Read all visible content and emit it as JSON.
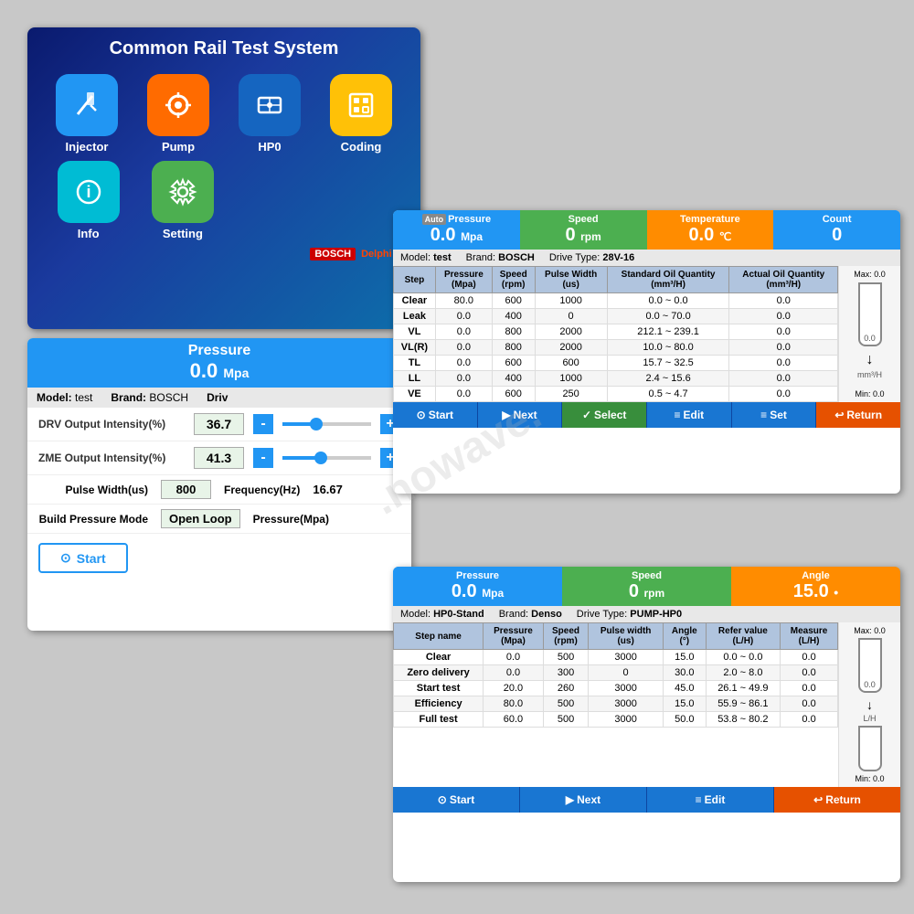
{
  "app": {
    "title": "Common Rail Test System",
    "watermark": ".nowave."
  },
  "main_menu": {
    "title": "Common Rail Test System",
    "items": [
      {
        "label": "Injector",
        "icon": "💉",
        "color": "blue"
      },
      {
        "label": "Pump",
        "icon": "🔧",
        "color": "orange"
      },
      {
        "label": "HP0",
        "icon": "⚙️",
        "color": "dark-blue"
      },
      {
        "label": "Coding",
        "icon": "📱",
        "color": "yellow"
      },
      {
        "label": "Info",
        "icon": "ℹ️",
        "color": "cyan"
      },
      {
        "label": "Setting",
        "icon": "⚙️",
        "color": "green"
      }
    ],
    "logos": "BOSCH  Delphi  DE"
  },
  "injector_panel": {
    "header": {
      "title": "Pressure",
      "value": "0.0",
      "unit": "Mpa"
    },
    "model_row": {
      "model_label": "Model:",
      "model_val": "test",
      "brand_label": "Brand:",
      "brand_val": "BOSCH",
      "drive_label": "Driv"
    },
    "controls": [
      {
        "label": "DRV Output Intensity(%)",
        "value": "36.7",
        "fill_pct": 38
      },
      {
        "label": "ZME Output Intensity(%)",
        "value": "41.3",
        "fill_pct": 43
      }
    ],
    "fields": [
      {
        "label": "Pulse Width(us)",
        "value": "800",
        "label2": "Frequency(Hz)",
        "val2": "16.67"
      },
      {
        "label": "Build Pressure Mode",
        "value": "Open Loop",
        "label2": "Pressure(Mpa)",
        "val2": ""
      }
    ],
    "start_btn": "Start"
  },
  "test_panel": {
    "header": {
      "pressure_label": "Pressure",
      "pressure_val": "0.0",
      "pressure_unit": "Mpa",
      "speed_label": "Speed",
      "speed_val": "0",
      "speed_unit": "rpm",
      "temp_label": "Temperature",
      "temp_val": "0.0",
      "temp_unit": "℃",
      "count_label": "Count",
      "count_val": "0"
    },
    "model_row": {
      "model": "test",
      "brand": "BOSCH",
      "drive_type": "28V-16"
    },
    "table": {
      "headers": [
        "Step",
        "Pressure\n(Mpa)",
        "Speed\n(rpm)",
        "Pulse Width\n(us)",
        "Standard Oil Quantity\n(mm³/H)",
        "Actual Oil Quantity\n(mm³/H)"
      ],
      "rows": [
        {
          "step": "Clear",
          "pressure": "80.0",
          "speed": "600",
          "pulse": "1000",
          "standard": "0.0 ~ 0.0",
          "actual": "0.0"
        },
        {
          "step": "Leak",
          "pressure": "0.0",
          "speed": "400",
          "pulse": "0",
          "standard": "0.0 ~ 70.0",
          "actual": "0.0"
        },
        {
          "step": "VL",
          "pressure": "0.0",
          "speed": "800",
          "pulse": "2000",
          "standard": "212.1 ~ 239.1",
          "actual": "0.0"
        },
        {
          "step": "VL(R)",
          "pressure": "0.0",
          "speed": "800",
          "pulse": "2000",
          "standard": "10.0 ~ 80.0",
          "actual": "0.0"
        },
        {
          "step": "TL",
          "pressure": "0.0",
          "speed": "600",
          "pulse": "600",
          "standard": "15.7 ~ 32.5",
          "actual": "0.0"
        },
        {
          "step": "LL",
          "pressure": "0.0",
          "speed": "400",
          "pulse": "1000",
          "standard": "2.4 ~ 15.6",
          "actual": "0.0"
        },
        {
          "step": "VE",
          "pressure": "0.0",
          "speed": "600",
          "pulse": "250",
          "standard": "0.5 ~ 4.7",
          "actual": "0.0"
        }
      ]
    },
    "gauge": {
      "max": "Max: 0.0",
      "min": "Min: 0.0",
      "unit": "mm³/H"
    },
    "buttons": [
      {
        "label": "Start",
        "icon": "▶"
      },
      {
        "label": "Next",
        "icon": "▶"
      },
      {
        "label": "Select",
        "icon": "✓"
      },
      {
        "label": "Edit",
        "icon": "≡"
      },
      {
        "label": "Set",
        "icon": "≡"
      },
      {
        "label": "Return",
        "icon": "↩"
      }
    ]
  },
  "hp0_panel": {
    "header": {
      "pressure_label": "Pressure",
      "pressure_val": "0.0",
      "pressure_unit": "Mpa",
      "speed_label": "Speed",
      "speed_val": "0",
      "speed_unit": "rpm",
      "angle_label": "Angle",
      "angle_val": "15.0",
      "angle_unit": "•"
    },
    "model_row": {
      "model": "HP0-Stand",
      "brand": "Denso",
      "drive_type": "PUMP-HP0"
    },
    "table": {
      "headers": [
        "Step name",
        "Pressure\n(Mpa)",
        "Speed\n(rpm)",
        "Pulse width\n(us)",
        "Angle\n(°)",
        "Refer value\n(L/H)",
        "Measure\n(L/H)"
      ],
      "rows": [
        {
          "step": "Clear",
          "pressure": "0.0",
          "speed": "500",
          "pulse": "3000",
          "angle": "15.0",
          "refer": "0.0 ~ 0.0",
          "measure": "0.0"
        },
        {
          "step": "Zero delivery",
          "pressure": "0.0",
          "speed": "300",
          "pulse": "0",
          "angle": "30.0",
          "refer": "2.0 ~ 8.0",
          "measure": "0.0"
        },
        {
          "step": "Start test",
          "pressure": "20.0",
          "speed": "260",
          "pulse": "3000",
          "angle": "45.0",
          "refer": "26.1 ~ 49.9",
          "measure": "0.0"
        },
        {
          "step": "Efficiency",
          "pressure": "80.0",
          "speed": "500",
          "pulse": "3000",
          "angle": "15.0",
          "refer": "55.9 ~ 86.1",
          "measure": "0.0"
        },
        {
          "step": "Full test",
          "pressure": "60.0",
          "speed": "500",
          "pulse": "3000",
          "angle": "50.0",
          "refer": "53.8 ~ 80.2",
          "measure": "0.0"
        }
      ]
    },
    "gauge": {
      "max": "Max: 0.0",
      "min": "Min: 0.0",
      "unit": "L/H"
    },
    "buttons": [
      {
        "label": "Start",
        "icon": "▶"
      },
      {
        "label": "Next",
        "icon": "▶"
      },
      {
        "label": "Edit",
        "icon": "≡"
      },
      {
        "label": "Return",
        "icon": "↩"
      }
    ]
  }
}
